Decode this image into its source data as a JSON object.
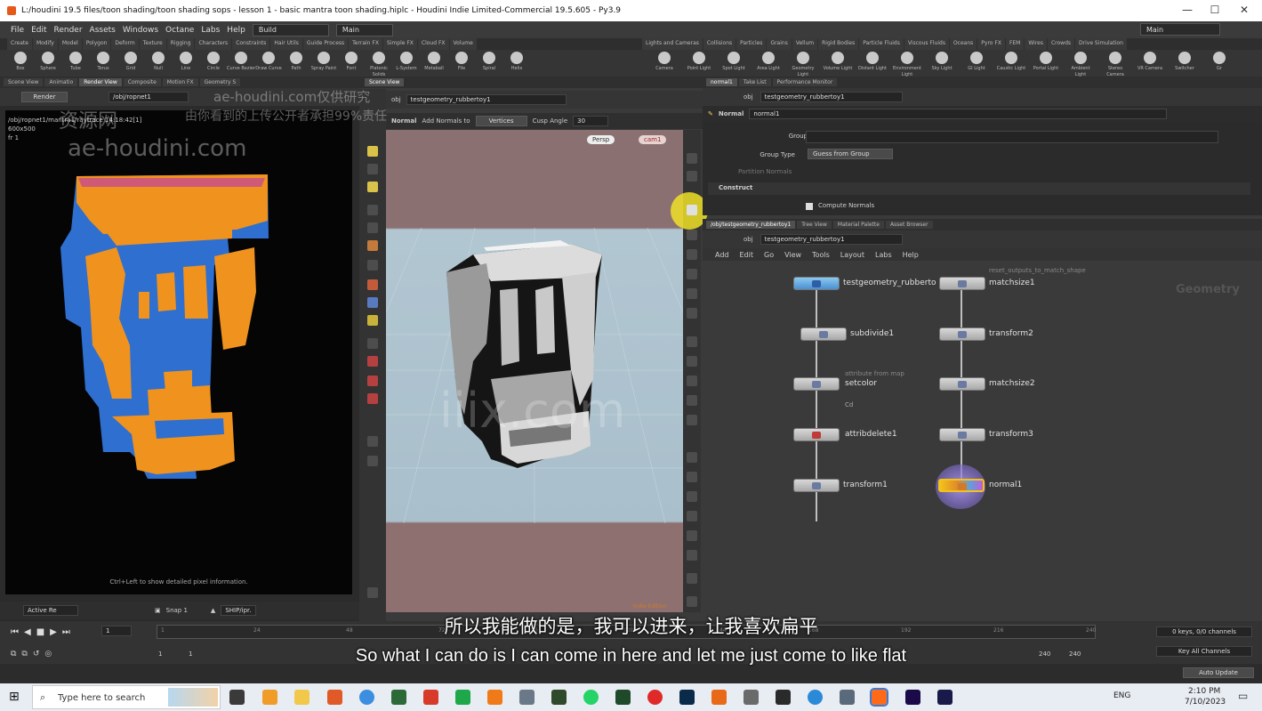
{
  "window": {
    "title": "L:/houdini 19.5 files/toon shading/toon shading sops - lesson 1 - basic mantra toon shading.hiplc - Houdini Indie Limited-Commercial 19.5.605 - Py3.9",
    "controls": [
      "—",
      "☐",
      "✕"
    ]
  },
  "menubar": {
    "items": [
      "File",
      "Edit",
      "Render",
      "Assets",
      "Windows",
      "Octane",
      "Labs",
      "Help"
    ],
    "desktop_left": "Build",
    "desktop_mid": "Main",
    "desktop_right": "Main"
  },
  "shelf": {
    "tabs_left": [
      "Create",
      "Modify",
      "Model",
      "Polygon",
      "Deform",
      "Texture",
      "Rigging",
      "Characters",
      "Constraints",
      "Hair Utils",
      "Guide Process",
      "Terrain FX",
      "Simple FX",
      "Cloud FX",
      "Volume"
    ],
    "tabs_right": [
      "Lights and Cameras",
      "Collisions",
      "Particles",
      "Grains",
      "Vellum",
      "Rigid Bodies",
      "Particle Fluids",
      "Viscous Fluids",
      "Oceans",
      "Pyro FX",
      "FEM",
      "Wires",
      "Crowds",
      "Drive Simulation"
    ],
    "tools_left": [
      "Box",
      "Sphere",
      "Tube",
      "Torus",
      "Grid",
      "Null",
      "Line",
      "Circle",
      "Curve Bezier",
      "Draw Curve",
      "Path",
      "Spray Paint",
      "Font",
      "Platonic Solids",
      "L-System",
      "Metaball",
      "File",
      "Spiral",
      "Helix"
    ],
    "tools_right": [
      "Camera",
      "Point Light",
      "Spot Light",
      "Area Light",
      "Geometry Light",
      "Volume Light",
      "Distant Light",
      "Environment Light",
      "Sky Light",
      "GI Light",
      "Caustic Light",
      "Portal Light",
      "Ambient Light",
      "Stereo Camera",
      "VR Camera",
      "Switcher",
      "Gr"
    ]
  },
  "render_view": {
    "tabs": [
      "Scene View",
      "Animatio",
      "Render View",
      "Composite",
      "Motion FX",
      "Geometry S"
    ],
    "render_button": "Render",
    "path": "/obj/ropnet1",
    "overlay_path": "/obj/ropnet1/mantra1/raytrace 14:18:42[1]",
    "resolution": "600x500",
    "frame_info": "fr 1",
    "hint": "Ctrl+Left to show detailed pixel information.",
    "bottom_left": "Active Re",
    "snap": "Snap 1",
    "rop": "SHIP/ipr."
  },
  "viewport": {
    "tab": "Scene View",
    "obj": "obj",
    "geo": "testgeometry_rubbertoy1",
    "tool_name": "Normal",
    "add_normals_to": "Add Normals to",
    "mode": "Vertices",
    "cusp_label": "Cusp Angle",
    "cusp_value": "30",
    "persp": "Persp",
    "cam": "cam1",
    "badge": "Indie Edition"
  },
  "params": {
    "tabs": [
      "normal1",
      "Take List",
      "Performance Monitor"
    ],
    "obj": "obj",
    "geo": "testgeometry_rubbertoy1",
    "node_type": "Normal",
    "node_name": "normal1",
    "group_label": "Group",
    "group_type_label": "Group Type",
    "group_type_value": "Guess from Group",
    "partition_label": "Partition Normals",
    "section": "Construct",
    "compute_normals": "Compute Normals"
  },
  "network": {
    "tabs": [
      "/obj/testgeometry_rubbertoy1",
      "Tree View",
      "Material Palette",
      "Asset Browser"
    ],
    "obj": "obj",
    "geo": "testgeometry_rubbertoy1",
    "menu": [
      "Add",
      "Edit",
      "Go",
      "View",
      "Tools",
      "Layout",
      "Labs",
      "Help"
    ],
    "context_label": "Geometry",
    "nodes": [
      {
        "name": "testgeometry_rubberto"
      },
      {
        "name": "subdivide1"
      },
      {
        "name": "setcolor",
        "sub": "Cd",
        "comment": "attribute from map"
      },
      {
        "name": "attribdelete1"
      },
      {
        "name": "transform1"
      },
      {
        "name": "matchsize1",
        "comment": "reset_outputs_to_match_shape"
      },
      {
        "name": "transform2"
      },
      {
        "name": "matchsize2"
      },
      {
        "name": "transform3"
      },
      {
        "name": "normal1"
      }
    ]
  },
  "timeline": {
    "frame": "1",
    "start": "1",
    "start2": "1",
    "ticks": [
      "1",
      "24",
      "48",
      "72",
      "96",
      "120",
      "144",
      "168",
      "192",
      "216",
      "240"
    ],
    "end": "240",
    "end2": "240",
    "keys_info": "0 keys, 0/0 channels",
    "key_all": "Key All Channels",
    "auto_update": "Auto Update"
  },
  "subtitles": {
    "zh": "所以我能做的是，我可以进来，让我喜欢扁平",
    "en": "So what I can do is I can come in here and let me just come to like flat"
  },
  "watermarks": {
    "cn_left": "资源网",
    "site_left": "ae-houdini.com",
    "site_top": "ae-houdini.com仅供研究",
    "cn_line": "由你看到的上传公开者承担99%责任",
    "center": "iiix.com"
  },
  "taskbar": {
    "search_placeholder": "Type here to search",
    "lang": "ENG",
    "time": "2:10 PM",
    "date": "7/10/2023"
  },
  "colors": {
    "render_blue": "#2f6fd0",
    "render_orange": "#f0921e",
    "viewport_top": "#8a6f70",
    "viewport_sky": "#9bb6c4",
    "selected_node": "#f2c318"
  }
}
